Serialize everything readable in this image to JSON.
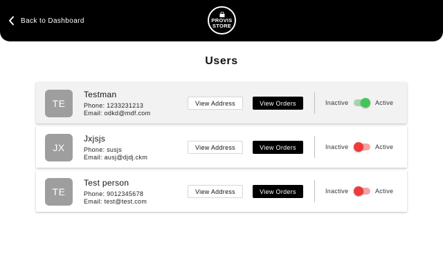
{
  "header": {
    "back_label": "Back to Dashboard",
    "logo_line1": "PROVIS",
    "logo_line2": "STORE"
  },
  "page": {
    "title": "Users"
  },
  "labels": {
    "view_address": "View Address",
    "view_orders": "View Orders",
    "inactive": "Inactive",
    "active": "Active"
  },
  "colors": {
    "toggle_on_track": "#a5d6a7",
    "toggle_on_thumb": "#43c45a",
    "toggle_off_track": "#f5a3a3",
    "toggle_off_thumb": "#ef3b3b"
  },
  "users": [
    {
      "initials": "TE",
      "name": "Testman",
      "phone": "Phone: 1233231213",
      "email": "Email: odkd@mdf.com",
      "active": true
    },
    {
      "initials": "JX",
      "name": "Jxjsjs",
      "phone": "Phone: susjs",
      "email": "Email: ausj@djdj.ckm",
      "active": false
    },
    {
      "initials": "TE",
      "name": "Test person",
      "phone": "Phone: 9012345678",
      "email": "Email: test@test.com",
      "active": false
    }
  ]
}
